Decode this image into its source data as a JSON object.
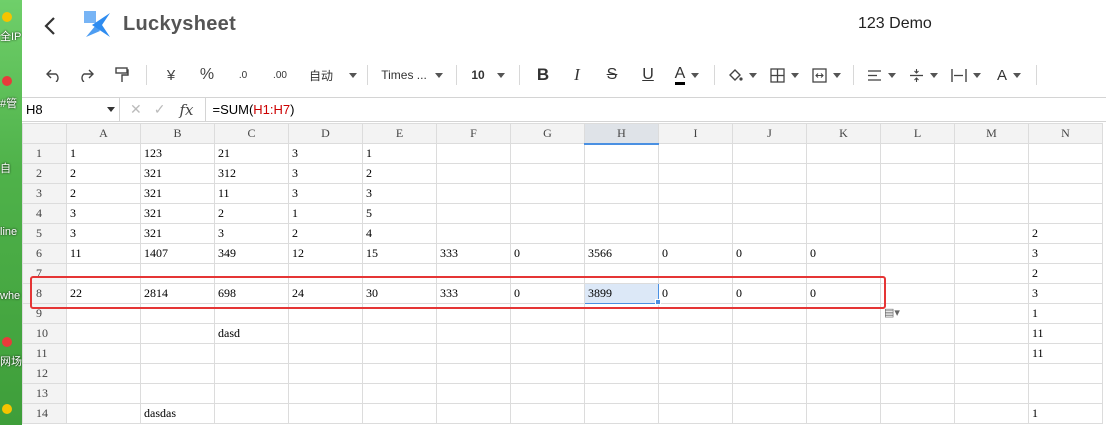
{
  "desktop": {
    "items": [
      "全IP",
      "#管",
      "自",
      "line",
      "whe",
      "网场"
    ]
  },
  "header": {
    "brand": "Luckysheet",
    "title": "123 Demo"
  },
  "toolbar": {
    "currency": "¥",
    "percent": "%",
    "dec_minus": ".0",
    "dec_plus": ".00",
    "format": "自动",
    "font": "Times ...",
    "size": "10",
    "bold": "B",
    "italic": "I",
    "strike": "S",
    "underline": "U",
    "textcolor": "A"
  },
  "formula": {
    "cell": "H8",
    "fx": "fx",
    "prefix": "=SUM(",
    "ref": "H1:H7",
    "suffix": ")"
  },
  "columns": [
    "A",
    "B",
    "C",
    "D",
    "E",
    "F",
    "G",
    "H",
    "I",
    "J",
    "K",
    "L",
    "M",
    "N"
  ],
  "rows": [
    {
      "n": "1",
      "cells": [
        "1",
        "123",
        "21",
        "3",
        "1",
        "",
        "",
        "",
        "",
        "",
        "",
        "",
        "",
        ""
      ]
    },
    {
      "n": "2",
      "cells": [
        "2",
        "321",
        "312",
        "3",
        "2",
        "",
        "",
        "",
        "",
        "",
        "",
        "",
        "",
        ""
      ]
    },
    {
      "n": "3",
      "cells": [
        "2",
        "321",
        "11",
        "3",
        "3",
        "",
        "",
        "",
        "",
        "",
        "",
        "",
        "",
        ""
      ]
    },
    {
      "n": "4",
      "cells": [
        "3",
        "321",
        "2",
        "1",
        "5",
        "",
        "",
        "",
        "",
        "",
        "",
        "",
        "",
        ""
      ]
    },
    {
      "n": "5",
      "cells": [
        "3",
        "321",
        "3",
        "2",
        "4",
        "",
        "",
        "",
        "",
        "",
        "",
        "",
        "",
        "2"
      ]
    },
    {
      "n": "6",
      "cells": [
        "11",
        "1407",
        "349",
        "12",
        "15",
        "333",
        "0",
        "3566",
        "0",
        "0",
        "0",
        "",
        "",
        "3"
      ]
    },
    {
      "n": "7",
      "cells": [
        "",
        "",
        "",
        "",
        "",
        "",
        "",
        "",
        "",
        "",
        "",
        "",
        "",
        "2"
      ]
    },
    {
      "n": "8",
      "cells": [
        "22",
        "2814",
        "698",
        "24",
        "30",
        "333",
        "0",
        "3899",
        "0",
        "0",
        "0",
        "",
        "",
        "3"
      ]
    },
    {
      "n": "9",
      "cells": [
        "",
        "",
        "",
        "",
        "",
        "",
        "",
        "",
        "",
        "",
        "",
        "",
        "",
        "1"
      ]
    },
    {
      "n": "10",
      "cells": [
        "",
        "",
        "dasd",
        "",
        "",
        "",
        "",
        "",
        "",
        "",
        "",
        "",
        "",
        "11"
      ]
    },
    {
      "n": "11",
      "cells": [
        "",
        "",
        "",
        "",
        "",
        "",
        "",
        "",
        "",
        "",
        "",
        "",
        "",
        "11"
      ]
    },
    {
      "n": "12",
      "cells": [
        "",
        "",
        "",
        "",
        "",
        "",
        "",
        "",
        "",
        "",
        "",
        "",
        "",
        ""
      ]
    },
    {
      "n": "13",
      "cells": [
        "",
        "",
        "",
        "",
        "",
        "",
        "",
        "",
        "",
        "",
        "",
        "",
        "",
        ""
      ]
    },
    {
      "n": "14",
      "cells": [
        "",
        "dasdas",
        "",
        "",
        "",
        "",
        "",
        "",
        "",
        "",
        "",
        "",
        "",
        "1"
      ]
    }
  ],
  "selection": {
    "row": "8",
    "col": "H"
  },
  "colors": {
    "accent": "#4a90e2",
    "highlight": "#e53535",
    "logo": "#2e8cf0"
  }
}
